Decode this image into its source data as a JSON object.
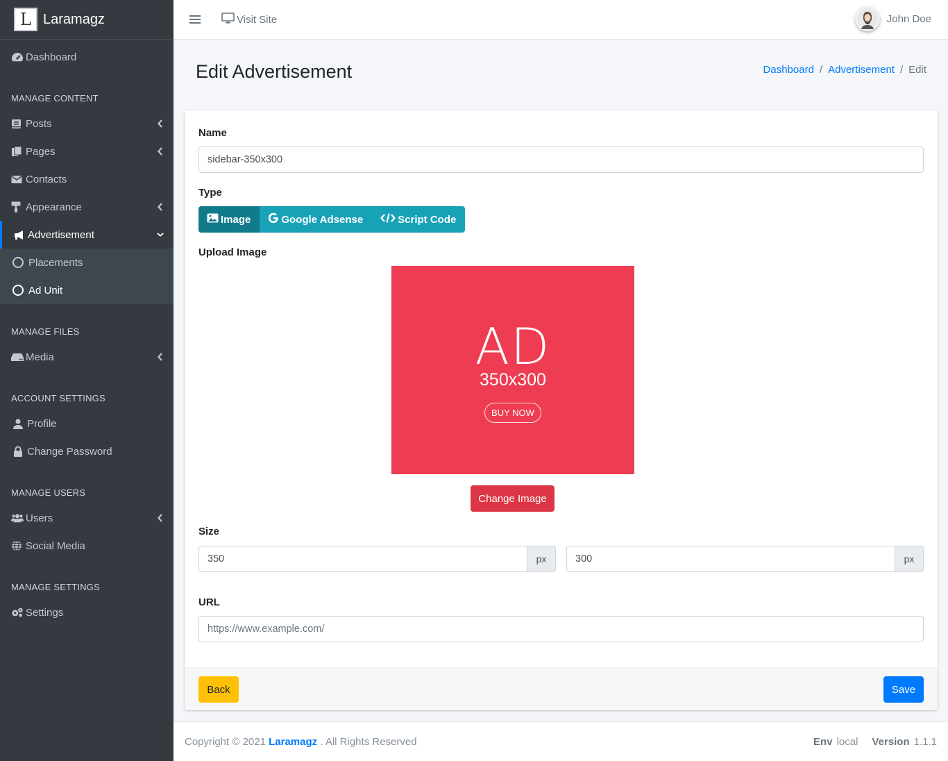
{
  "brand": {
    "logo_letter": "L",
    "name": "Laramagz"
  },
  "sidebar": {
    "dashboard": "Dashboard",
    "sections": {
      "content": "MANAGE CONTENT",
      "files": "MANAGE FILES",
      "account": "ACCOUNT SETTINGS",
      "users": "MANAGE USERS",
      "settings": "MANAGE SETTINGS"
    },
    "items": {
      "posts": "Posts",
      "pages": "Pages",
      "contacts": "Contacts",
      "appearance": "Appearance",
      "advertisement": "Advertisement",
      "placements": "Placements",
      "ad_unit": "Ad Unit",
      "media": "Media",
      "profile": "Profile",
      "change_password": "Change Password",
      "users": "Users",
      "social_media": "Social Media",
      "settings": "Settings"
    }
  },
  "topbar": {
    "visit_site": "Visit Site",
    "user_name": "John Doe"
  },
  "page": {
    "title": "Edit Advertisement"
  },
  "breadcrumb": {
    "dashboard": "Dashboard",
    "advertisement": "Advertisement",
    "current": "Edit",
    "separator": "/"
  },
  "form": {
    "name_label": "Name",
    "name_value": "sidebar-350x300",
    "type_label": "Type",
    "type_options": {
      "image": "Image",
      "adsense": "Google Adsense",
      "script": "Script Code"
    },
    "type_selected": "Image",
    "upload_label": "Upload Image",
    "ad_preview": {
      "title": "AD",
      "size": "350x300",
      "cta": "BUY NOW"
    },
    "change_image": "Change Image",
    "size_label": "Size",
    "width_value": "350",
    "height_value": "300",
    "unit": "px",
    "url_label": "URL",
    "url_placeholder": "https://www.example.com/"
  },
  "actions": {
    "back": "Back",
    "save": "Save"
  },
  "footer": {
    "copyright_prefix": "Copyright © 2021",
    "brand": "Laramagz",
    "rights": ". All Rights Reserved",
    "env_label": "Env",
    "env_value": "local",
    "version_label": "Version",
    "version_value": "1.1.1"
  },
  "colors": {
    "sidebar_bg": "#343a40",
    "accent": "#007bff",
    "info": "#17a2b8",
    "danger": "#dc3545",
    "warning": "#ffc107",
    "ad_bg": "#ee3c52"
  }
}
